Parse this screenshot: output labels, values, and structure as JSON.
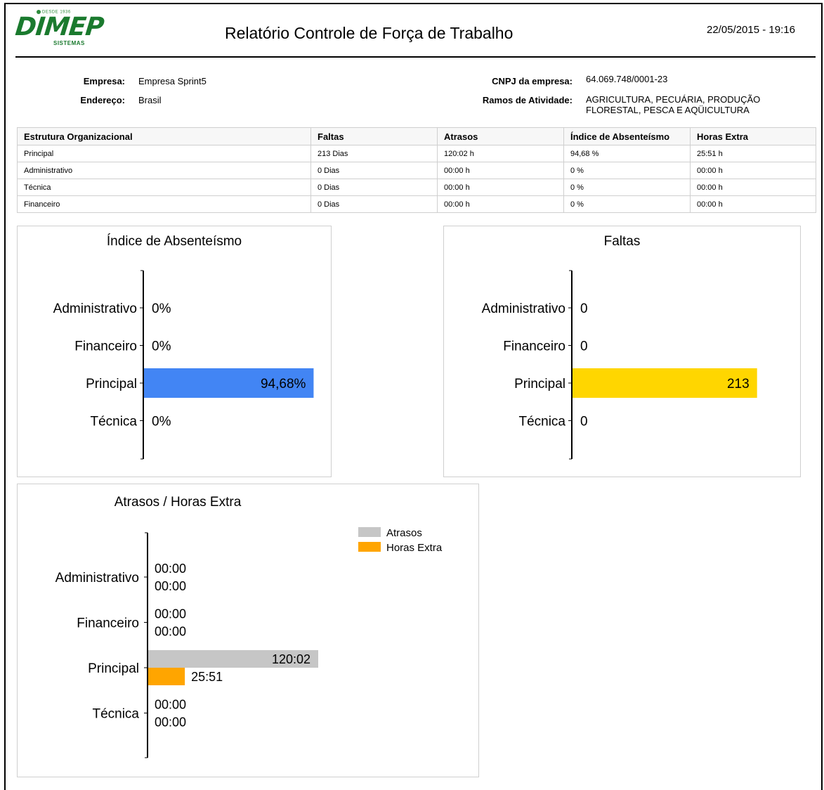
{
  "header": {
    "logo_since": "DESDE 1936",
    "logo_text": "DIMEP",
    "logo_sub": "SISTEMAS",
    "title": "Relatório Controle de Força de Trabalho",
    "datetime": "22/05/2015 - 19:16"
  },
  "info": {
    "empresa_label": "Empresa:",
    "empresa_value": "Empresa Sprint5",
    "endereco_label": "Endereço:",
    "endereco_value": "Brasil",
    "cnpj_label": "CNPJ da empresa:",
    "cnpj_value": "64.069.748/0001-23",
    "ramos_label": "Ramos de Atividade:",
    "ramos_value": "AGRICULTURA, PECUÁRIA, PRODUÇÃO FLORESTAL, PESCA E AQÜICULTURA"
  },
  "table": {
    "headers": [
      "Estrutura Organizacional",
      "Faltas",
      "Atrasos",
      "Índice de Absenteísmo",
      "Horas Extra"
    ],
    "rows": [
      [
        "Principal",
        "213 Dias",
        "120:02 h",
        "94,68 %",
        "25:51 h"
      ],
      [
        "Administrativo",
        "0 Dias",
        "00:00 h",
        "0 %",
        "00:00 h"
      ],
      [
        "Técnica",
        "0 Dias",
        "00:00 h",
        "0 %",
        "00:00 h"
      ],
      [
        "Financeiro",
        "0 Dias",
        "00:00 h",
        "0 %",
        "00:00 h"
      ]
    ]
  },
  "chart_data": [
    {
      "type": "bar",
      "orientation": "horizontal",
      "title": "Índice de Absenteísmo",
      "categories": [
        "Administrativo",
        "Financeiro",
        "Principal",
        "Técnica"
      ],
      "values": [
        0,
        0,
        94.68
      ],
      "value_labels": [
        "0%",
        "0%",
        "94,68%",
        "0%"
      ],
      "values_full": [
        0,
        0,
        94.68,
        0
      ],
      "color": "#4285f4",
      "xlim": [
        0,
        100
      ],
      "legend": "none",
      "grid": false
    },
    {
      "type": "bar",
      "orientation": "horizontal",
      "title": "Faltas",
      "categories": [
        "Administrativo",
        "Financeiro",
        "Principal",
        "Técnica"
      ],
      "values": [
        0,
        0,
        213,
        0
      ],
      "value_labels": [
        "0",
        "0",
        "213",
        "0"
      ],
      "color": "#ffd600",
      "xlim": [
        0,
        240
      ],
      "legend": "none",
      "grid": false
    },
    {
      "type": "bar",
      "orientation": "horizontal",
      "title": "Atrasos / Horas Extra",
      "categories": [
        "Administrativo",
        "Financeiro",
        "Principal",
        "Técnica"
      ],
      "series": [
        {
          "name": "Atrasos",
          "values": [
            0,
            0,
            120.03,
            0
          ],
          "labels": [
            "00:00",
            "00:00",
            "120:02",
            "00:00"
          ],
          "color": "#c6c6c6"
        },
        {
          "name": "Horas Extra",
          "values": [
            0,
            0,
            25.85,
            0
          ],
          "labels": [
            "00:00",
            "00:00",
            "25:51",
            "00:00"
          ],
          "color": "#ffa500"
        }
      ],
      "xlim": [
        0,
        250
      ],
      "legend": "top-right",
      "grid": false
    }
  ]
}
